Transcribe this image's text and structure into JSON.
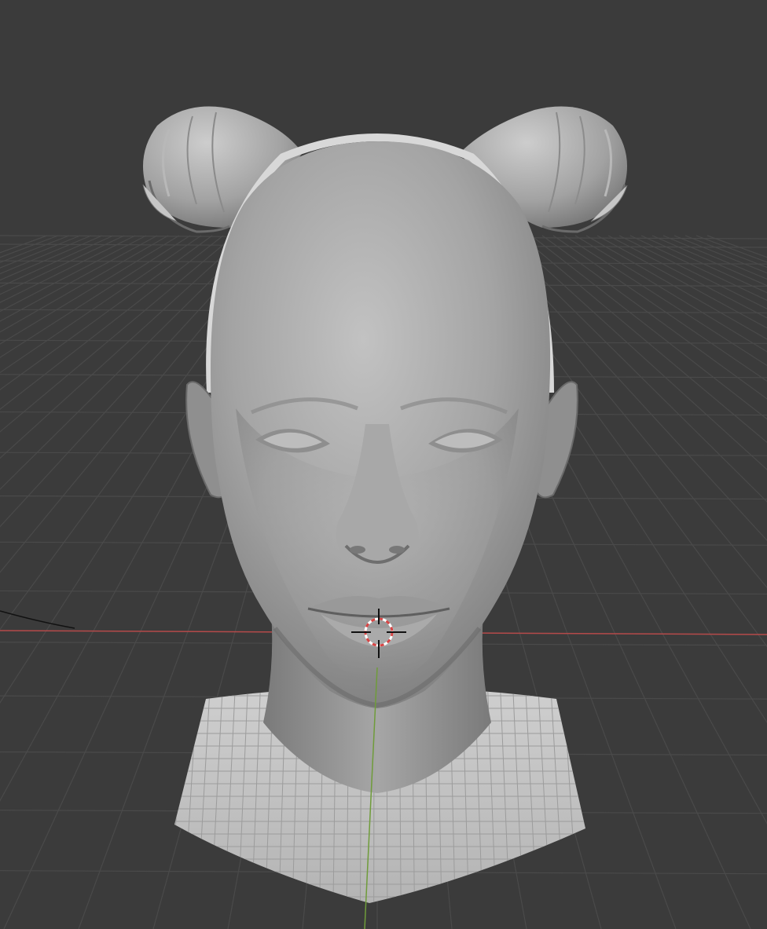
{
  "viewport": {
    "background_color": "#3b3b3b",
    "grid_line_color": "#4a4a4a",
    "x_axis_color": "#b54a4a",
    "y_axis_color": "#6f9c3a",
    "model_base_color": "#9a9a9a",
    "horn_color": "#9e9e9e"
  },
  "model": {
    "name": "sculpted-head-with-horns"
  },
  "cursor_3d": {
    "ring_color": "#d64545",
    "crosshair_color": "#111111"
  },
  "icons": [
    "3d-cursor-icon"
  ]
}
